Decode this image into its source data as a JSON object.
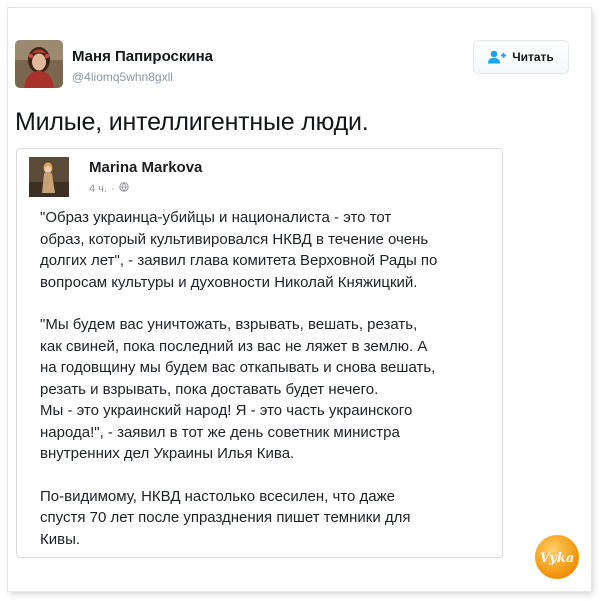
{
  "tweet": {
    "display_name": "Маня Папироскина",
    "handle": "@4liomq5whn8gxll",
    "follow_label": "Читать",
    "text": "Милые, интеллигентные люди."
  },
  "embed": {
    "author": "Marina Markova",
    "time": "4 ч.",
    "separator": "·",
    "paragraphs": [
      {
        "lines": [
          "\"Образ украинца-убийцы и националиста - это тот",
          "образ, который культивировался НКВД в течение очень",
          "долгих лет\", - заявил глава комитета Верховной Рады по",
          "вопросам культуры и духовности Николай Княжицкий."
        ]
      },
      {
        "lines": [
          "\"Мы будем вас уничтожать, взрывать, вешать, резать,",
          "как свиней, пока последний из вас не ляжет в землю. А",
          "на годовщину мы будем вас откапывать и снова вешать,",
          "резать и взрывать, пока доставать будет нечего.",
          "Мы - это украинский народ! Я - это часть украинского",
          "народа!\", - заявил в тот же день советник министра",
          "внутренних дел Украины Илья Кива."
        ]
      },
      {
        "lines": [
          "По-видимому, НКВД настолько всесилен, что даже",
          "спустя 70 лет после упразднения пишет темники для",
          "Кивы."
        ]
      }
    ]
  },
  "icons": {
    "follow": "add-user-icon",
    "privacy": "globe-icon",
    "watermark": "yaplakal-watermark-logo"
  },
  "colors": {
    "accent": "#1da1f2",
    "watermark": "#f5a31a"
  },
  "watermark_text": "Vyka"
}
